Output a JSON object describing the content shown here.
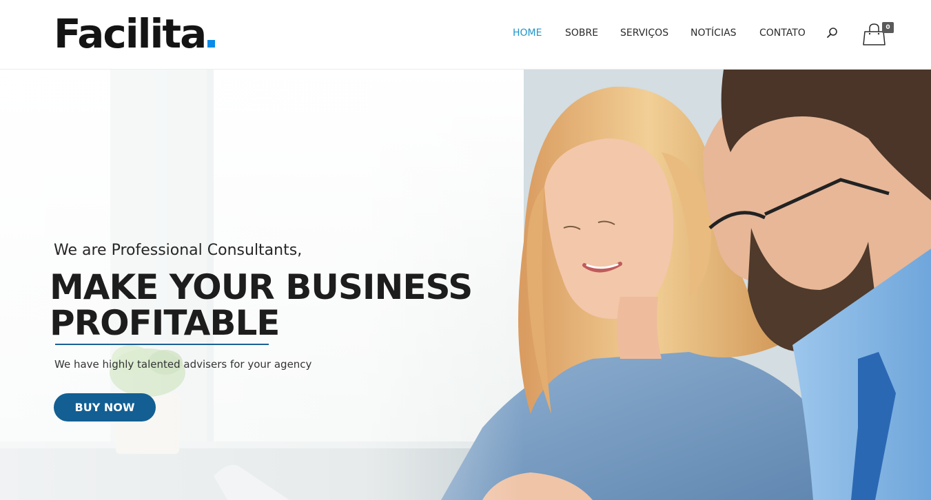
{
  "header": {
    "logo_text": "Facilita",
    "nav": [
      {
        "label": "HOME",
        "active": true
      },
      {
        "label": "SOBRE",
        "active": false
      },
      {
        "label": "SERVIÇOS",
        "active": false
      },
      {
        "label": "NOTÍCIAS",
        "active": false
      },
      {
        "label": "CONTATO",
        "active": false
      }
    ],
    "search_icon": "search-icon",
    "cart_icon": "shopping-bag-icon",
    "cart_count": "0"
  },
  "hero": {
    "pretitle": "We are Professional Consultants,",
    "title_line1": "MAKE YOUR BUSINESS",
    "title_line2": "PROFITABLE",
    "subtitle": "We have highly talented advisers for your agency",
    "button_label": "BUY NOW"
  },
  "colors": {
    "accent": "#1e95c9",
    "logo_dot": "#0a8ce8",
    "button": "#135f93",
    "underline": "#1a5e96",
    "text_dark": "#1d1d1d"
  }
}
